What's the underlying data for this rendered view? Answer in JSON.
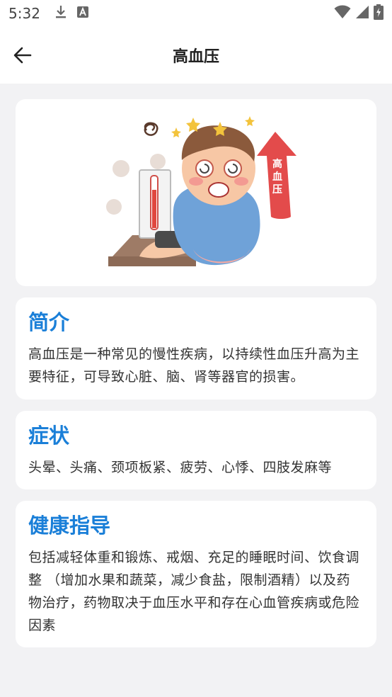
{
  "status_bar": {
    "time": "5:32",
    "icons": [
      "download-icon",
      "text-a-icon",
      "wifi-icon",
      "signal-icon",
      "battery-icon"
    ]
  },
  "app_bar": {
    "title": "高血压",
    "back_icon": "arrow-left-icon"
  },
  "hero": {
    "image": "hypertension-illustration",
    "badge_text": "高血压"
  },
  "sections": {
    "intro": {
      "heading": "简介",
      "body": "高血压是一种常见的慢性疾病，以持续性血压升高为主要特征，可导致心脏、脑、肾等器官的损害。"
    },
    "symptoms": {
      "heading": "症状",
      "body": "头晕、头痛、颈项板紧、疲劳、心悸、四肢发麻等"
    },
    "guidance": {
      "heading": "健康指导",
      "body": "包括减轻体重和锻炼、戒烟、充足的睡眠时间、饮食调整 （增加水果和蔬菜，减少食盐，限制酒精）以及药物治疗，药物取决于血压水平和存在心血管疾病或危险因素"
    }
  },
  "colors": {
    "accent": "#1a7fd8",
    "background": "#f2f2f4",
    "card": "#ffffff",
    "text": "#333333"
  }
}
